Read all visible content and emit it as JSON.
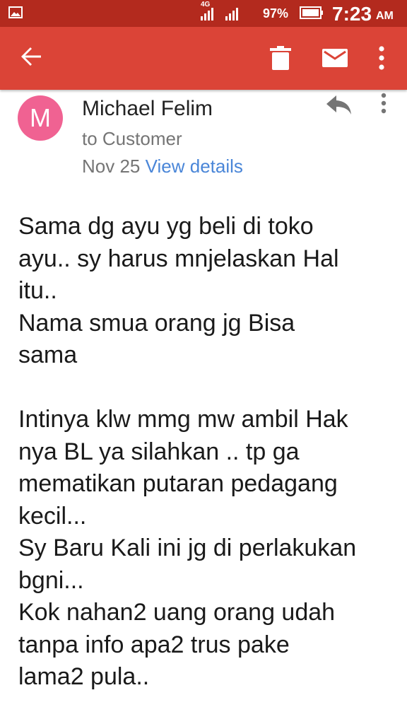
{
  "status_bar": {
    "network": "4G",
    "battery_percent": "97%",
    "time": "7:23",
    "ampm": "AM"
  },
  "toolbar": {
    "icons": [
      "back-arrow-icon",
      "trash-icon",
      "mail-icon",
      "more-vert-icon"
    ]
  },
  "email": {
    "avatar_letter": "M",
    "sender": "Michael Felim",
    "recipient": "to Customer",
    "date": "Nov 25",
    "view_details": "View details",
    "body_lines": [
      "Sama dg ayu yg beli di toko",
      "ayu.. sy harus mnjelaskan Hal",
      "itu..",
      "Nama smua orang jg Bisa",
      "sama",
      "",
      "Intinya klw mmg mw ambil Hak",
      "nya BL ya silahkan .. tp ga",
      "mematikan putaran pedagang",
      "kecil...",
      "Sy Baru Kali ini jg di perlakukan",
      "bgni...",
      "Kok nahan2 uang orang udah",
      "tanpa info apa2 trus pake",
      "lama2 pula.."
    ]
  },
  "colors": {
    "status_bar": "#B32A1E",
    "app_bar": "#DB4437",
    "avatar": "#F06292",
    "link": "#4A86D8"
  }
}
